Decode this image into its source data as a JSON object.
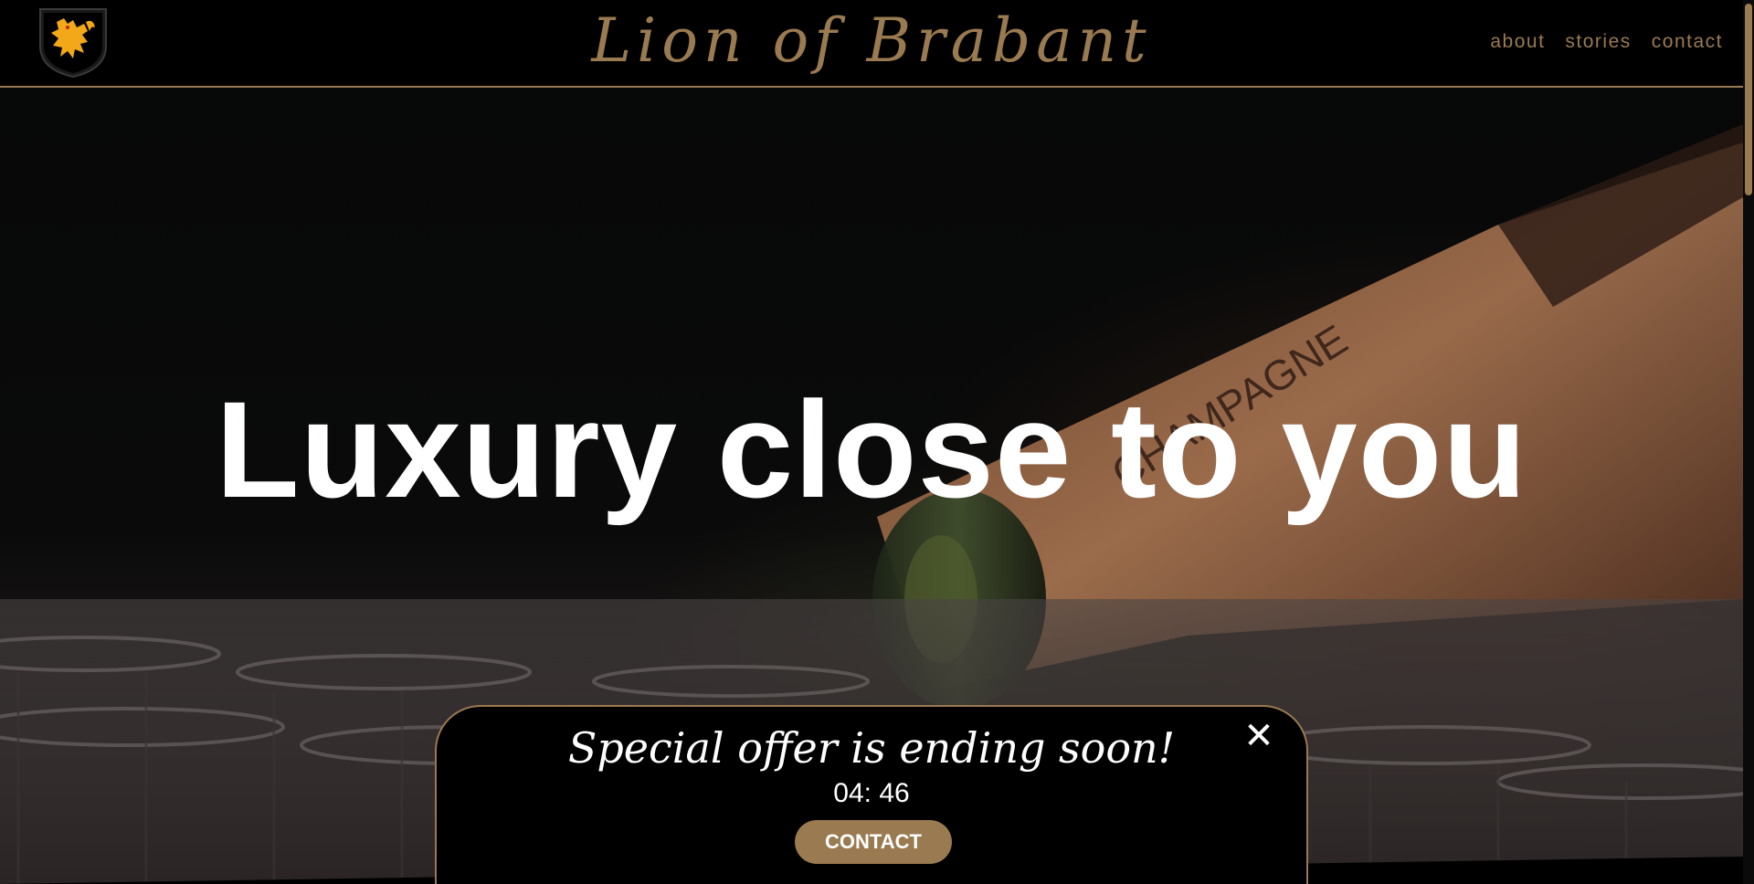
{
  "header": {
    "brand": "Lion of Brabant",
    "logo_icon": "lion-shield-icon",
    "nav": [
      {
        "label": "about"
      },
      {
        "label": "stories"
      },
      {
        "label": "contact"
      }
    ]
  },
  "hero": {
    "title": "Luxury close to you",
    "bottle_label": "CHAMPAGNE"
  },
  "offer": {
    "title": "Special offer is ending soon!",
    "timer": "04: 46",
    "button_label": "CONTACT",
    "close_icon": "close-icon"
  },
  "colors": {
    "accent": "#9a7a50",
    "background": "#000000",
    "text": "#ffffff",
    "logo_gold": "#f2a818"
  }
}
